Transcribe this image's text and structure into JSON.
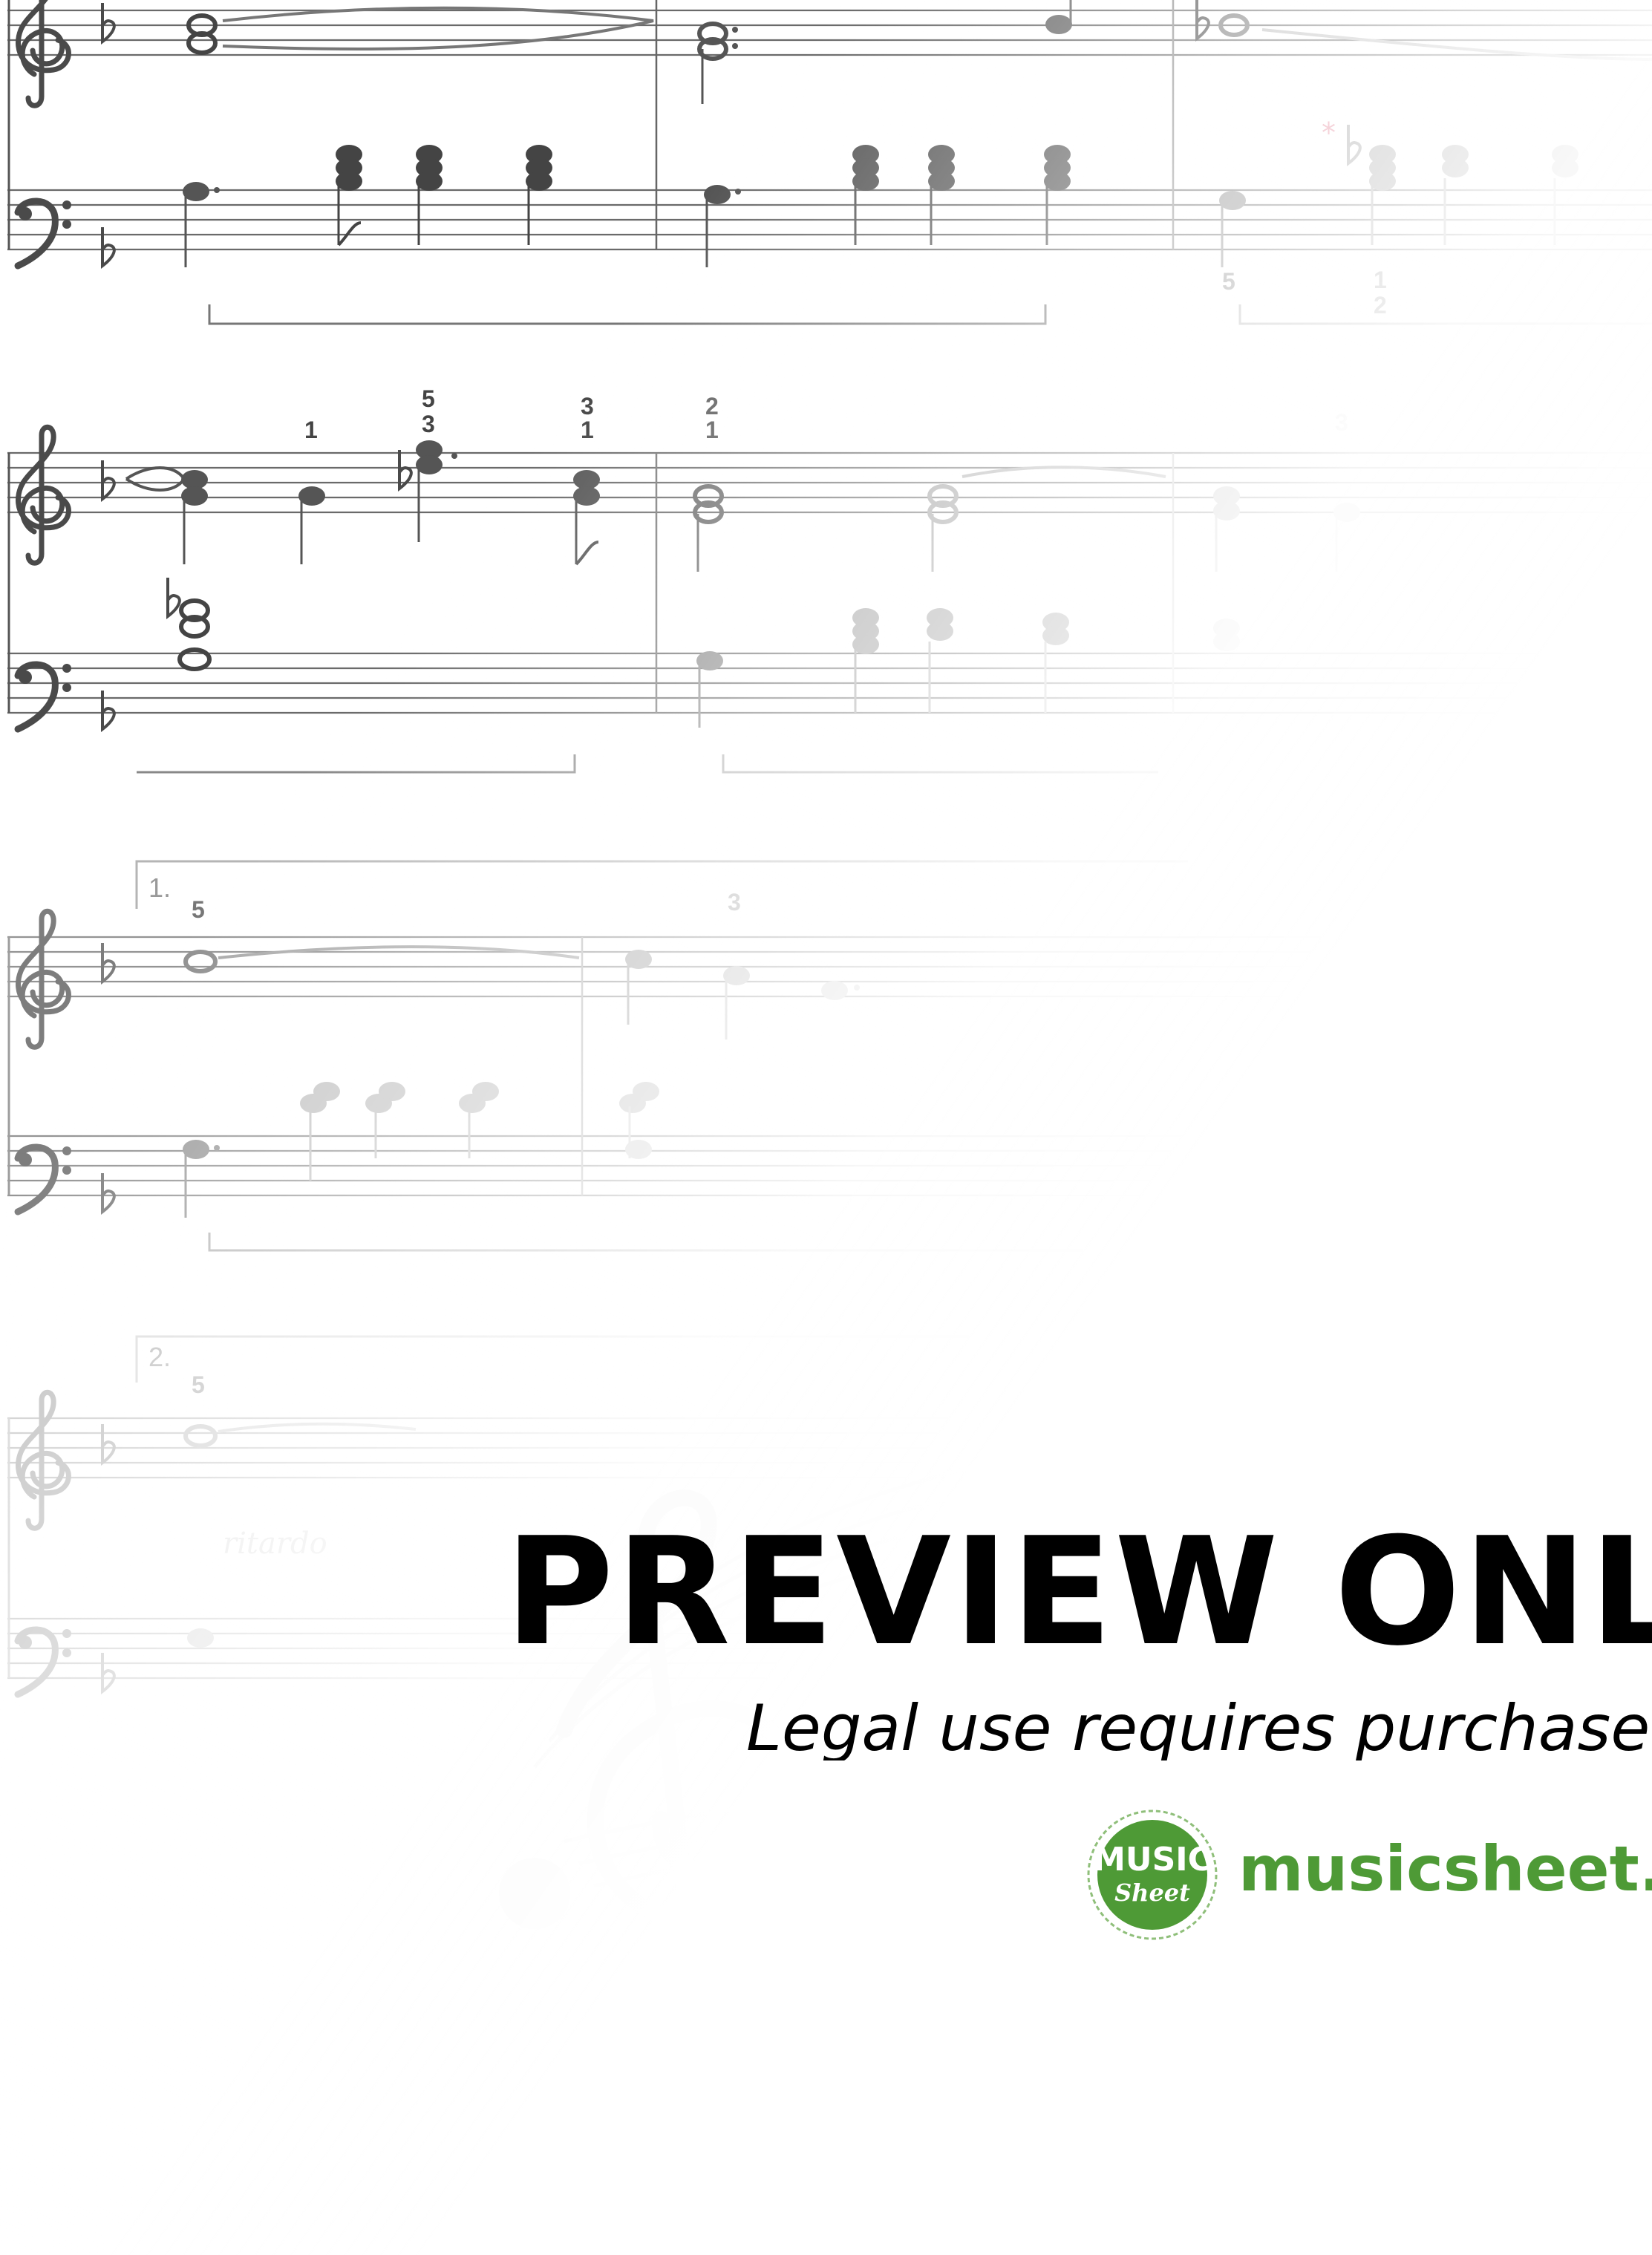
{
  "score": {
    "fingerings": [
      "5",
      "1",
      "2",
      "1",
      "5",
      "3",
      "3",
      "1",
      "2",
      "1",
      "3",
      "5",
      "3",
      "5"
    ],
    "volta_1": "1.",
    "volta_2": "2.",
    "tempo_marking": "ritardo",
    "colors": {
      "ink": "#444444",
      "note": "#555555",
      "light": "#c4c4c4",
      "pedal_star": "#e07a8e"
    }
  },
  "watermark": {
    "headline": "PREVIEW ONLY",
    "subline": "Legal use requires purchase",
    "logo_line1": "MUSIC",
    "logo_line2": "Sheet",
    "website": "musicsheet.org",
    "colors": {
      "text": "#000000",
      "brand_green": "#4e9a36"
    }
  }
}
